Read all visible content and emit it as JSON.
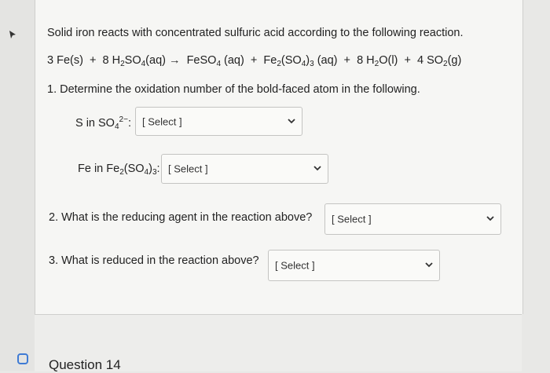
{
  "intro": "Solid iron reacts with concentrated sulfuric acid according to the following reaction.",
  "equation": {
    "fe_solid": "3 Fe(s)",
    "plus1": "+",
    "h2so4": {
      "coef": "8 H",
      "s1": "2",
      "mid": "SO",
      "s2": "4",
      "tail": "(aq)"
    },
    "arrow": "→",
    "feso4": {
      "pre": "FeSO",
      "s1": "4",
      "tail": "(aq)"
    },
    "plus2": "+",
    "fe2so43": {
      "pre": "Fe",
      "s1": "2",
      "mid": "(SO",
      "s2": "4",
      "mid2": ")",
      "s3": "3",
      "tail": "(aq)"
    },
    "plus3": "+",
    "h2o": {
      "coef": "8 H",
      "s1": "2",
      "tail": "O(l)"
    },
    "plus4": "+",
    "so2": {
      "coef": "4 SO",
      "s1": "2",
      "tail": "(g)"
    }
  },
  "q1": {
    "label": "1. Determine the oxidation number of the bold-faced atom in the following.",
    "part_a": {
      "pre": "S in SO",
      "sub": "4",
      "sup": "2−",
      "post": ":",
      "select": "[ Select ]"
    },
    "part_b": {
      "pre": "Fe in Fe",
      "s1": "2",
      "mid": "(SO",
      "s2": "4",
      "mid2": ")",
      "s3": "3",
      "post": ":",
      "select": "[ Select ]"
    }
  },
  "q2": {
    "label": "2. What is the reducing agent in the reaction above?",
    "select": "[ Select ]"
  },
  "q3": {
    "label": "3. What is reduced in the reaction above?",
    "select": "[ Select ]"
  },
  "next_question": "Question 14"
}
